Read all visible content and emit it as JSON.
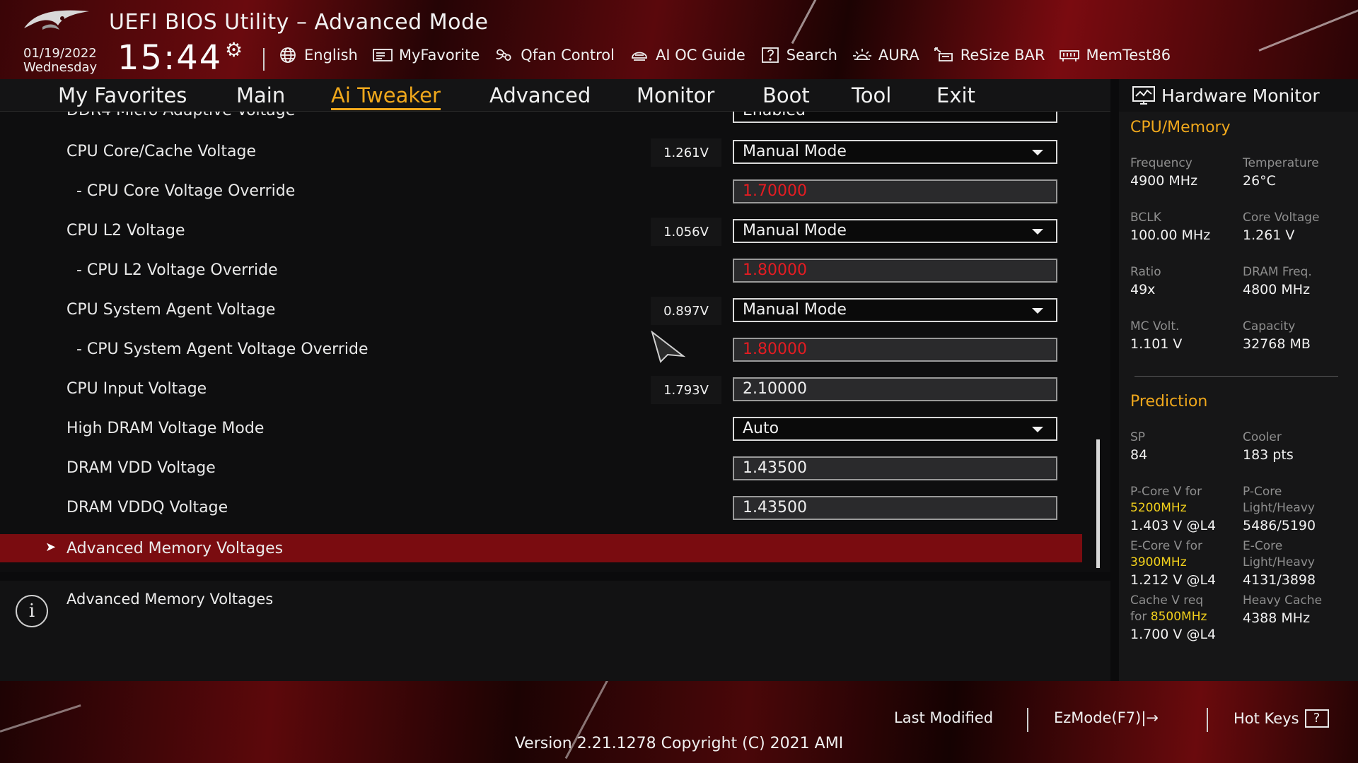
{
  "header": {
    "title": "UEFI BIOS Utility – Advanced Mode",
    "date": "01/19/2022",
    "weekday": "Wednesday",
    "time": "15:44",
    "toolbar": [
      {
        "label": "English",
        "icon": "globe-icon"
      },
      {
        "label": "MyFavorite",
        "icon": "favorite-icon"
      },
      {
        "label": "Qfan Control",
        "icon": "fan-icon"
      },
      {
        "label": "AI OC Guide",
        "icon": "oc-guide-icon"
      },
      {
        "label": "Search",
        "icon": "search-icon"
      },
      {
        "label": "AURA",
        "icon": "aura-icon"
      },
      {
        "label": "ReSize BAR",
        "icon": "resize-bar-icon"
      },
      {
        "label": "MemTest86",
        "icon": "memtest-icon"
      }
    ]
  },
  "menu": {
    "active": "Ai Tweaker",
    "items": [
      "My Favorites",
      "Main",
      "Ai Tweaker",
      "Advanced",
      "Monitor",
      "Boot",
      "Tool",
      "Exit"
    ]
  },
  "settings": {
    "partial_row": {
      "label": "DDR4 Micro Adaptive Voltage",
      "value": "Enabled"
    },
    "rows": [
      {
        "label": "CPU Core/Cache Voltage",
        "reading": "1.261V",
        "value": "Manual Mode",
        "kind": "dropdown",
        "sub": false
      },
      {
        "label": "- CPU Core Voltage Override",
        "reading": "",
        "value": "1.70000",
        "kind": "input-red",
        "sub": true
      },
      {
        "label": "CPU L2 Voltage",
        "reading": "1.056V",
        "value": "Manual Mode",
        "kind": "dropdown",
        "sub": false
      },
      {
        "label": "- CPU L2 Voltage Override",
        "reading": "",
        "value": "1.80000",
        "kind": "input-red",
        "sub": true
      },
      {
        "label": "CPU System Agent Voltage",
        "reading": "0.897V",
        "value": "Manual Mode",
        "kind": "dropdown",
        "sub": false
      },
      {
        "label": "- CPU System Agent Voltage Override",
        "reading": "",
        "value": "1.80000",
        "kind": "input-red",
        "sub": true
      },
      {
        "label": "CPU Input Voltage",
        "reading": "1.793V",
        "value": "2.10000",
        "kind": "input",
        "sub": false
      },
      {
        "label": "High DRAM Voltage Mode",
        "reading": "",
        "value": "Auto",
        "kind": "dropdown",
        "sub": false
      },
      {
        "label": "DRAM VDD Voltage",
        "reading": "",
        "value": "1.43500",
        "kind": "input",
        "sub": false
      },
      {
        "label": "DRAM VDDQ Voltage",
        "reading": "",
        "value": "1.43500",
        "kind": "input",
        "sub": false
      }
    ],
    "submenu": {
      "label": "Advanced Memory Voltages",
      "arrow": "➤"
    }
  },
  "help": {
    "text": "Advanced Memory Voltages",
    "icon": "info-icon"
  },
  "hardware_monitor": {
    "title": "Hardware Monitor",
    "cpu_memory": {
      "title": "CPU/Memory",
      "items": [
        {
          "key": "Frequency",
          "value": "4900 MHz"
        },
        {
          "key": "Temperature",
          "value": "26°C"
        },
        {
          "key": "BCLK",
          "value": "100.00 MHz"
        },
        {
          "key": "Core Voltage",
          "value": "1.261 V"
        },
        {
          "key": "Ratio",
          "value": "49x"
        },
        {
          "key": "DRAM Freq.",
          "value": "4800 MHz"
        },
        {
          "key": "MC Volt.",
          "value": "1.101 V"
        },
        {
          "key": "Capacity",
          "value": "32768 MB"
        }
      ]
    },
    "prediction": {
      "title": "Prediction",
      "sp_key": "SP",
      "sp_value": "84",
      "cooler_key": "Cooler",
      "cooler_value": "183 pts",
      "pcore_key1": "P-Core V for",
      "pcore_freq": "5200MHz",
      "pcore_value": "1.403 V @L4",
      "pcore_lh_key1": "P-Core",
      "pcore_lh_key2": "Light/Heavy",
      "pcore_lh_value": "5486/5190",
      "ecore_key1": "E-Core V for",
      "ecore_freq": "3900MHz",
      "ecore_value": "1.212 V @L4",
      "ecore_lh_key1": "E-Core",
      "ecore_lh_key2": "Light/Heavy",
      "ecore_lh_value": "4131/3898",
      "cache_key1": "Cache V req",
      "cache_key2_prefix": "for ",
      "cache_freq": "8500MHz",
      "cache_value": "1.700 V @L4",
      "heavy_cache_key": "Heavy Cache",
      "heavy_cache_value": "4388 MHz"
    }
  },
  "footer": {
    "last_modified": "Last Modified",
    "ezmode": "EzMode(F7)|→",
    "hotkeys": "Hot Keys",
    "hotkeys_key": "?",
    "version": "Version 2.21.1278 Copyright (C) 2021 AMI"
  },
  "colors": {
    "accent": "#f0a81c",
    "selected_row": "#7a0c10",
    "override_value": "#e41c22",
    "prediction_freq": "#f3d11c"
  }
}
